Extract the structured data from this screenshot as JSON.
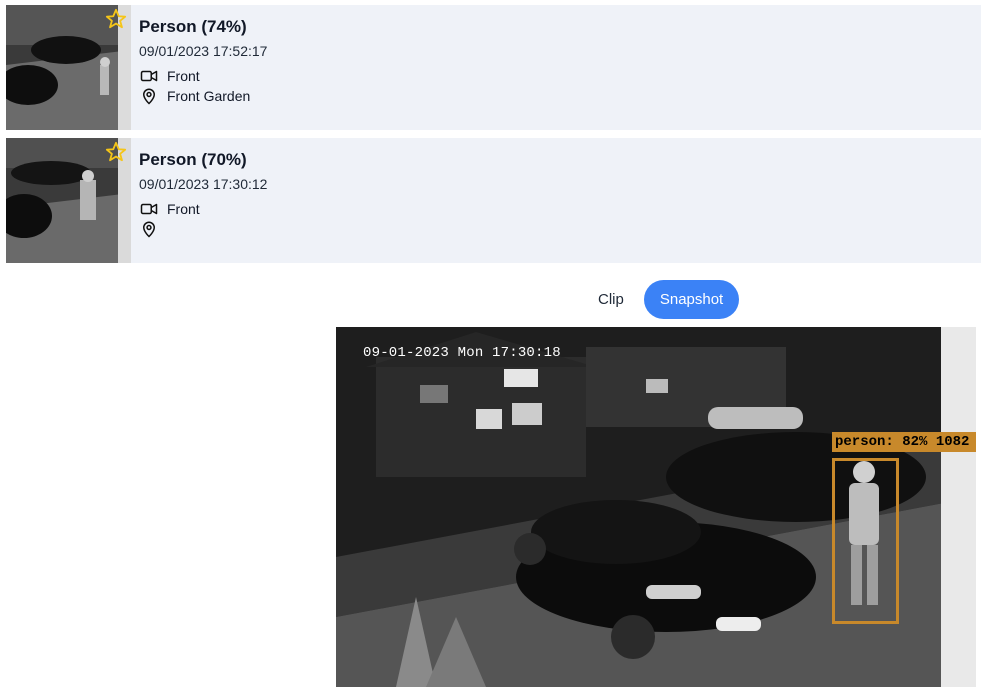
{
  "events": [
    {
      "label": "Person (74%)",
      "timestamp": "09/01/2023 17:52:17",
      "camera": "Front",
      "zone": "Front Garden",
      "starred": true
    },
    {
      "label": "Person (70%)",
      "timestamp": "09/01/2023 17:30:12",
      "camera": "Front",
      "zone": "",
      "starred": true
    }
  ],
  "view_toggle": {
    "clip_label": "Clip",
    "snapshot_label": "Snapshot",
    "selected": "Snapshot"
  },
  "snapshot": {
    "camera_timestamp": "09-01-2023 Mon 17:30:18",
    "detection_label": "person: 82% 1082"
  },
  "colors": {
    "accent": "#3b82f6",
    "card_bg": "#eff2f8",
    "star": "#f5c518",
    "detection": "#c8892b"
  },
  "icons": {
    "star": "star-icon",
    "camera": "video-camera-icon",
    "zone": "map-pin-icon"
  }
}
